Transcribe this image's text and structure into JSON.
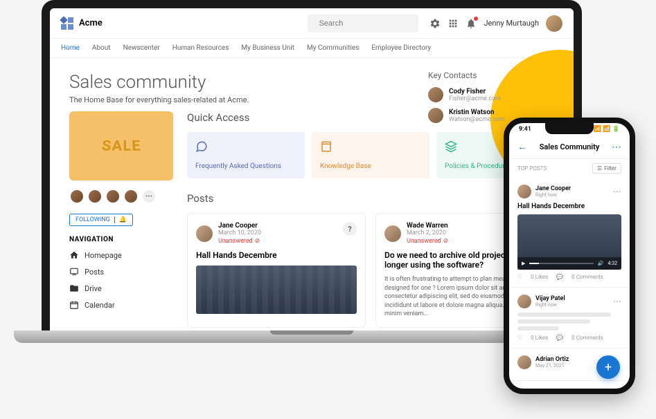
{
  "header": {
    "brand": "Acme",
    "search_placeholder": "Search",
    "user_name": "Jenny Murtaugh"
  },
  "nav_tabs": [
    "Home",
    "About",
    "Newscenter",
    "Human Resources",
    "My Business Unit",
    "My Communities",
    "Employee Directory"
  ],
  "hero": {
    "title": "Sales community",
    "subtitle": "The Home Base for everything sales-related at Acme."
  },
  "key_contacts": {
    "title": "Key Contacts",
    "items": [
      {
        "name": "Cody Fisher",
        "email": "Fisher@acme.com"
      },
      {
        "name": "Kristin Watson",
        "email": "Watson@acme.com"
      }
    ]
  },
  "sidebar": {
    "sale_label": "SALE",
    "following_label": "FOLLOWING",
    "nav_title": "NAVIGATION",
    "nav_items": [
      "Homepage",
      "Posts",
      "Drive",
      "Calendar"
    ]
  },
  "quick_access": {
    "title": "Quick Access",
    "cards": [
      "Frequently Asked Questions",
      "Knowledge Base",
      "Policies & Procedures"
    ]
  },
  "posts": {
    "title": "Posts",
    "items": [
      {
        "author": "Jane Cooper",
        "date": "March 10, 2020",
        "status": "Unanswered",
        "title": "Hall Hands Decembre"
      },
      {
        "author": "Wade Warren",
        "date": "March 2, 2020",
        "status": "Unanswered",
        "title": "Do we need to archive old projects if we no longer using the software?",
        "body": "It is often frustrating to attempt to plan meals that are designed for one ? Lorem ipsum dolor sit amet, consectetur adipiscing elit, sed do eiusmod tempor incididunt ut labore et dolore magna aliqua. Ut enim ad minim veniam..."
      }
    ]
  },
  "mobile": {
    "time": "9:41",
    "header_title": "Sales Community",
    "top_posts_label": "TOP POSTS",
    "filter_label": "Filter",
    "posts": [
      {
        "author": "Jane Cooper",
        "time": "Right now",
        "title": "Hall Hands Decembre",
        "likes": "0 Likes",
        "comments": "0 Comments",
        "duration": "4:32"
      },
      {
        "author": "Vijay Patel",
        "time": "Right now",
        "likes": "0 Likes",
        "comments": "0 Comments"
      },
      {
        "author": "Adrian Ortiz",
        "time": "May 21, 2021"
      }
    ]
  }
}
